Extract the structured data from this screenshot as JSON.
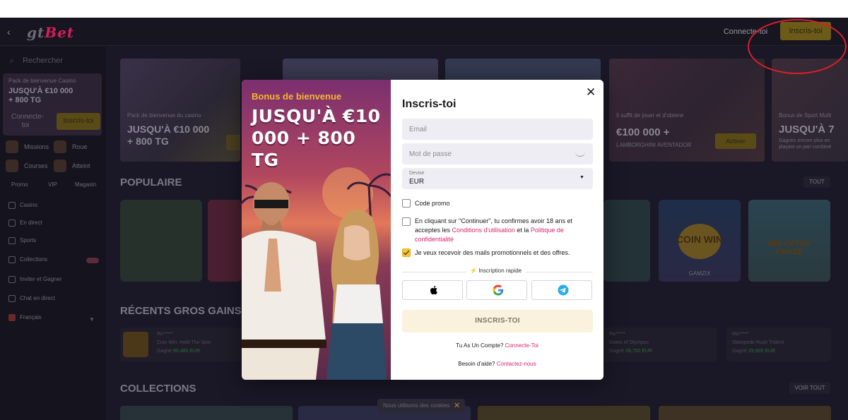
{
  "header": {
    "connect_label": "Connecte-toi",
    "signup_label": "Inscris-toi"
  },
  "sidebar": {
    "search_placeholder": "Rechercher",
    "promo": {
      "subtitle": "Pack de bienvenue Casino",
      "headline": "JUSQU'À €10 000 + 800 TG",
      "connect_label": "Connecte-toi",
      "signup_label": "Inscris-toi"
    },
    "tiles": [
      "Missions",
      "Roue",
      "Courses",
      "Atteint"
    ],
    "tabs": [
      "Promo",
      "VIP",
      "Magasin"
    ],
    "items": [
      "Casino",
      "En direct",
      "Sports",
      "Collections",
      "Inviter et Gagner",
      "Chat en direct",
      "Français"
    ]
  },
  "main": {
    "banners": [
      {
        "subtitle": "Pack de bienvenue du casino",
        "headline": "JUSQU'À €10 000 + 800 TG"
      },
      {
        "subtitle": "Il suffit de jouer et d'obtenir",
        "headline": "€100 000 +",
        "line2": "LAMBORGHINI AVENTADOR",
        "button": "Activer"
      },
      {
        "subtitle": "Bonus de Sport Multi",
        "headline": "JUSQU'À 7",
        "line2": "Gagnez encore plus en plaçant un pari combiné"
      }
    ],
    "popular_title": "POPULAIRE",
    "popular_all": "TOUT",
    "games": [
      "COIN WIN",
      "BIG CATCH CRAZE"
    ],
    "game_provider": "GAMZIX",
    "wins_title": "RÉCENTS GROS GAINS",
    "win_cards": [
      {
        "user": "Ro*****",
        "game": "Coin Win: Hold The Spin",
        "label": "Gagné",
        "amount": "60,480 EUR"
      },
      {
        "user": "Ra*****",
        "game": "Gates of Olympus",
        "label": "Gagné",
        "amount": "28,700 EUR"
      },
      {
        "user": "Ma*****",
        "game": "Stampede Rush Trident",
        "label": "Gagné",
        "amount": "29,900 EUR"
      }
    ],
    "collections_title": "COLLECTIONS",
    "collections_all": "VOIR TOUT"
  },
  "modal": {
    "bonus_label": "Bonus de bienvenue",
    "bonus_headline": "JUSQU'À €10 000 + 800 TG",
    "title": "Inscris-toi",
    "email_placeholder": "Email",
    "password_placeholder": "Mot de passe",
    "currency_label": "Devise",
    "currency_value": "EUR",
    "promo_code_label": "Code promo",
    "terms_prefix": "En cliquant sur \"Continuer\", tu confirmes avoir 18 ans et acceptes les ",
    "terms_link": "Conditions d'utilisation",
    "terms_mid": " et la ",
    "privacy_link": "Politique de confidentialité",
    "marketing_label": "Je veux recevoir des mails promotionnels et des offres.",
    "quick_signup": "Inscription rapide",
    "submit_label": "INSCRIS-TOI",
    "account_prompt": "Tu As Un Compte?",
    "account_link": "Connecte-Toi",
    "help_prompt": "Besoin d'aide?",
    "help_link": "Contactez-nous"
  },
  "cookie": {
    "text": "Nous utilisons des cookies"
  },
  "colors": {
    "accent": "#f5c236",
    "link": "#d9256d",
    "annotation": "#d8202a",
    "background": "#1a1827"
  }
}
